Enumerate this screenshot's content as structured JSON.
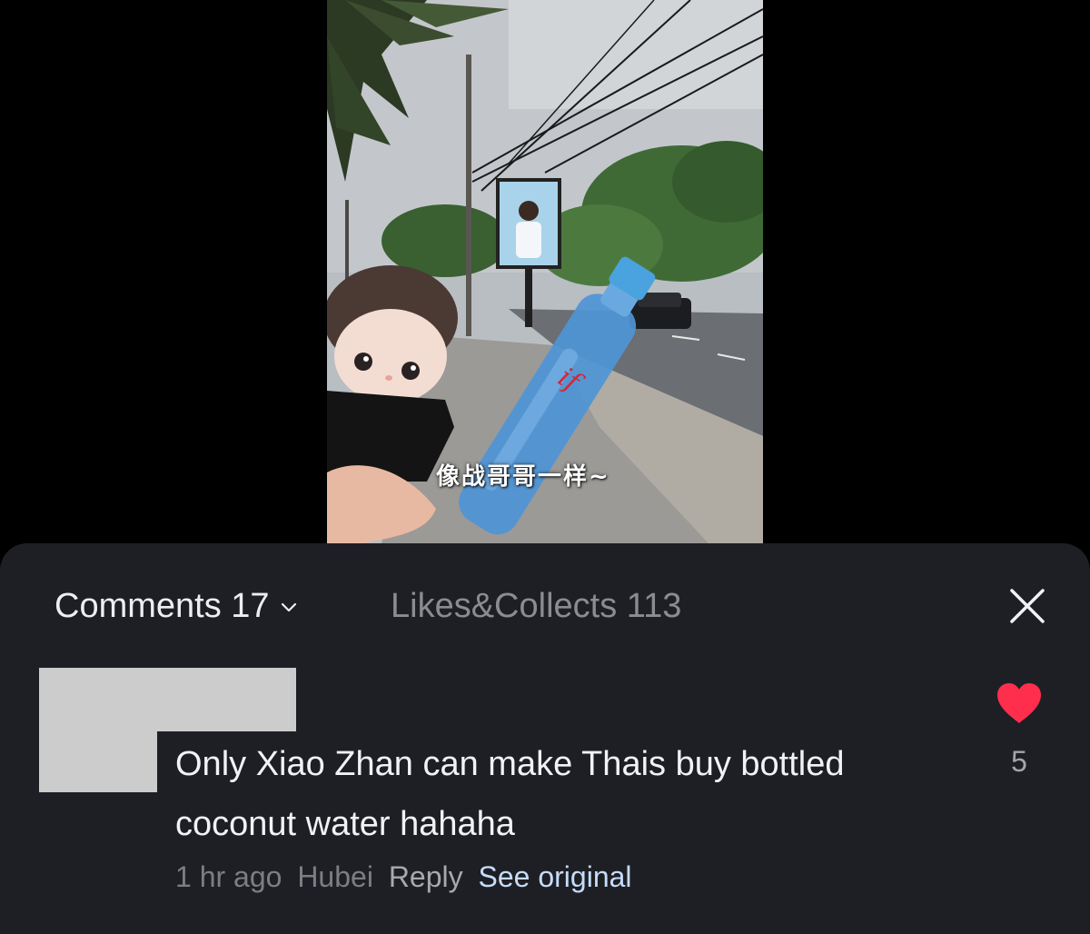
{
  "video": {
    "caption": "像战哥哥一样~",
    "bottle_logo_text": "if"
  },
  "comments_panel": {
    "tabs": {
      "comments_label": "Comments",
      "comments_count": "17",
      "likes_label": "Likes&Collects",
      "likes_count": "113"
    },
    "close_icon": "close-icon",
    "dropdown_icon": "chevron-down-icon"
  },
  "comment": {
    "avatar": "redacted",
    "text": "Only Xiao Zhan can make Thais buy bottled coconut water hahaha",
    "time": "1 hr ago",
    "location": "Hubei",
    "reply_label": "Reply",
    "see_original_label": "See original",
    "like_icon": "heart-icon",
    "like_count": "5"
  },
  "colors": {
    "sheet_background": "#1e1f24",
    "heart": "#ff2e4d",
    "link": "#c5dcf8",
    "muted_text": "#7c7e84"
  }
}
